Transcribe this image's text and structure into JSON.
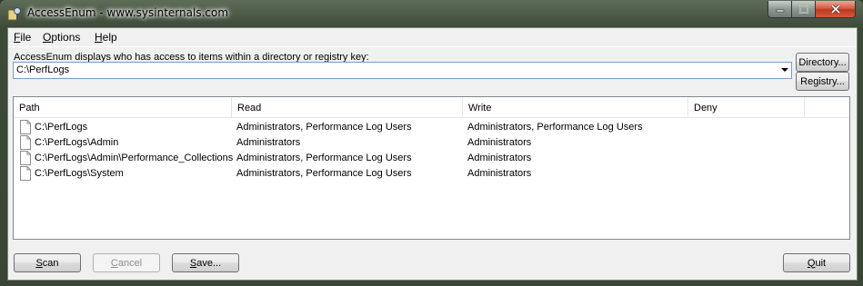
{
  "window": {
    "title": "AccessEnum - www.sysinternals.com"
  },
  "menu": [
    {
      "label": "File",
      "accel": "F",
      "rest": "ile"
    },
    {
      "label": "Options",
      "accel": "O",
      "rest": "ptions"
    },
    {
      "label": "Help",
      "accel": "H",
      "rest": "elp"
    }
  ],
  "description": "AccessEnum displays who has access to items within a directory or registry key:",
  "path_input": {
    "value": "C:\\PerfLogs"
  },
  "buttons": {
    "directory": "Directory...",
    "registry": "Registry...",
    "scan_accel": "S",
    "scan_rest": "can",
    "cancel_accel": "C",
    "cancel_rest": "ancel",
    "save_accel": "S",
    "save_rest": "ave...",
    "quit_accel": "Q",
    "quit_rest": "uit"
  },
  "table": {
    "columns": [
      "Path",
      "Read",
      "Write",
      "Deny"
    ],
    "rows": [
      {
        "path": "C:\\PerfLogs",
        "read": "Administrators, Performance Log Users",
        "write": "Administrators, Performance Log Users",
        "deny": ""
      },
      {
        "path": "C:\\PerfLogs\\Admin",
        "read": "Administrators",
        "write": "Administrators",
        "deny": ""
      },
      {
        "path": "C:\\PerfLogs\\Admin\\Performance_Collections",
        "read": "Administrators, Performance Log Users",
        "write": "Administrators",
        "deny": ""
      },
      {
        "path": "C:\\PerfLogs\\System",
        "read": "Administrators, Performance Log Users",
        "write": "Administrators",
        "deny": ""
      }
    ]
  },
  "icons": {
    "app": "accessenum-app-icon",
    "minimize": "minimize-icon",
    "maximize": "maximize-icon",
    "close": "close-icon",
    "row": "document-icon"
  }
}
